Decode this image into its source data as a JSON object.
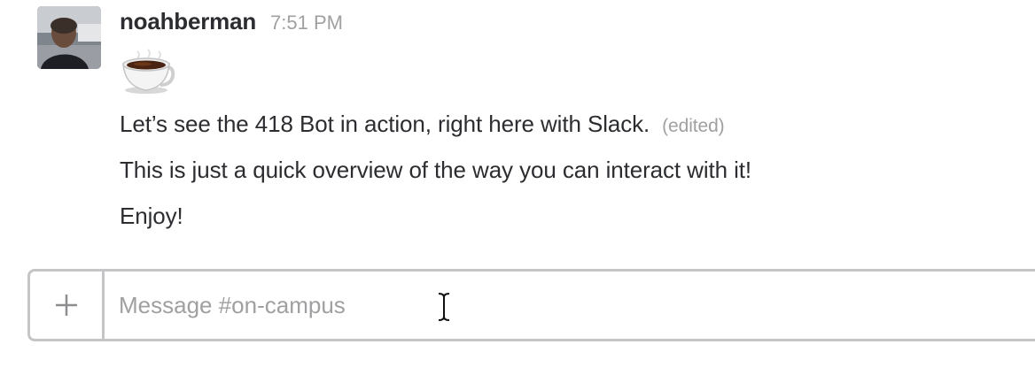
{
  "message": {
    "username": "noahberman",
    "timestamp": "7:51 PM",
    "emoji": "coffee",
    "lines": [
      "Let’s see the 418 Bot in action, right here with Slack.",
      "This is just a quick overview of the way you can interact with it!",
      "Enjoy!"
    ],
    "edited_label": "(edited)"
  },
  "composer": {
    "attach_icon": "plus-icon",
    "placeholder": "Message #on-campus",
    "value": ""
  },
  "cursor": {
    "type": "text-ibeam-cursor"
  }
}
